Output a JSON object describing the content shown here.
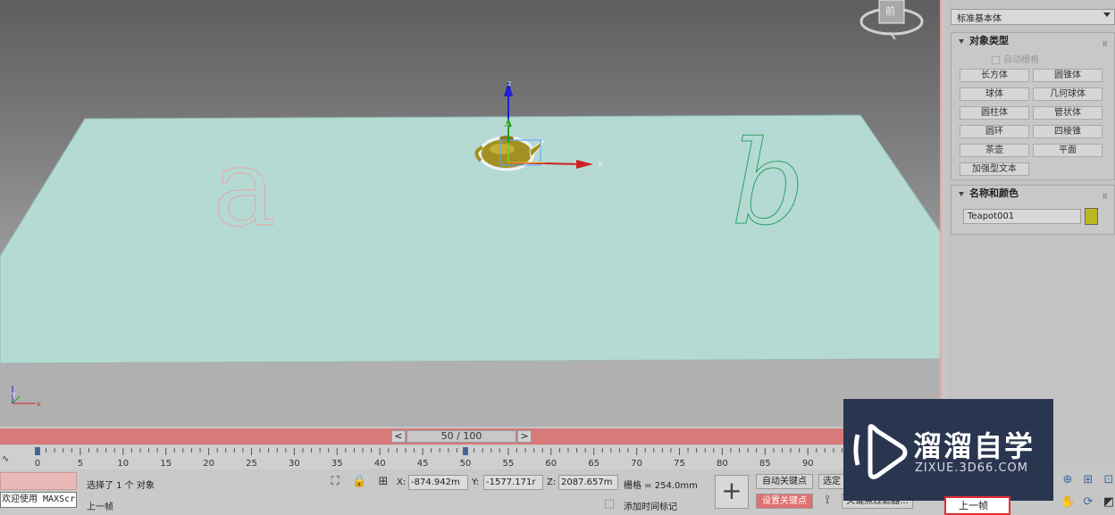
{
  "viewport": {
    "viewcube_label": "前",
    "letter_a": "a",
    "letter_b": "b",
    "gizmo_z": "z",
    "gizmo_y": "y",
    "gizmo_x": "x",
    "axis_y": "y",
    "axis_x": "x"
  },
  "command_panel": {
    "category_dropdown": "标准基本体",
    "object_type_title": "对象类型",
    "auto_grid_label": "自动栅格",
    "object_buttons": [
      "长方体",
      "圆锥体",
      "球体",
      "几何球体",
      "圆柱体",
      "管状体",
      "圆环",
      "四棱锥",
      "茶壶",
      "平面",
      "加强型文本"
    ],
    "name_color_title": "名称和颜色",
    "object_name": "Teapot001",
    "object_color": "#b8b820"
  },
  "timebar": {
    "prev_label": "<",
    "next_label": ">",
    "frame_display": "50 / 100"
  },
  "track": {
    "ticks": [
      "0",
      "5",
      "10",
      "15",
      "20",
      "25",
      "30",
      "35",
      "40",
      "45",
      "50",
      "55",
      "60",
      "65",
      "70",
      "75",
      "80",
      "85",
      "90"
    ]
  },
  "status": {
    "maxscript_text": "欢迎使用 MAXScr",
    "selection_text": "选择了 1 个 对象",
    "prompt_text": "上一帧",
    "x_label": "X:",
    "x_value": "-874.942m",
    "y_label": "Y:",
    "y_value": "-1577.171r",
    "z_label": "Z:",
    "z_value": "2087.657m",
    "grid_text": "栅格 = 254.0mm",
    "add_time_tag": "添加时间标记",
    "auto_key": "自动关键点",
    "set_key": "设置关键点",
    "selected_label": "选定",
    "key_filters": "关键点过滤器..."
  },
  "watermark": {
    "title": "溜溜自学",
    "url": "ZIXUE.3D66.COM"
  },
  "bottom_right": {
    "prev_frame_label": "上一帧"
  }
}
